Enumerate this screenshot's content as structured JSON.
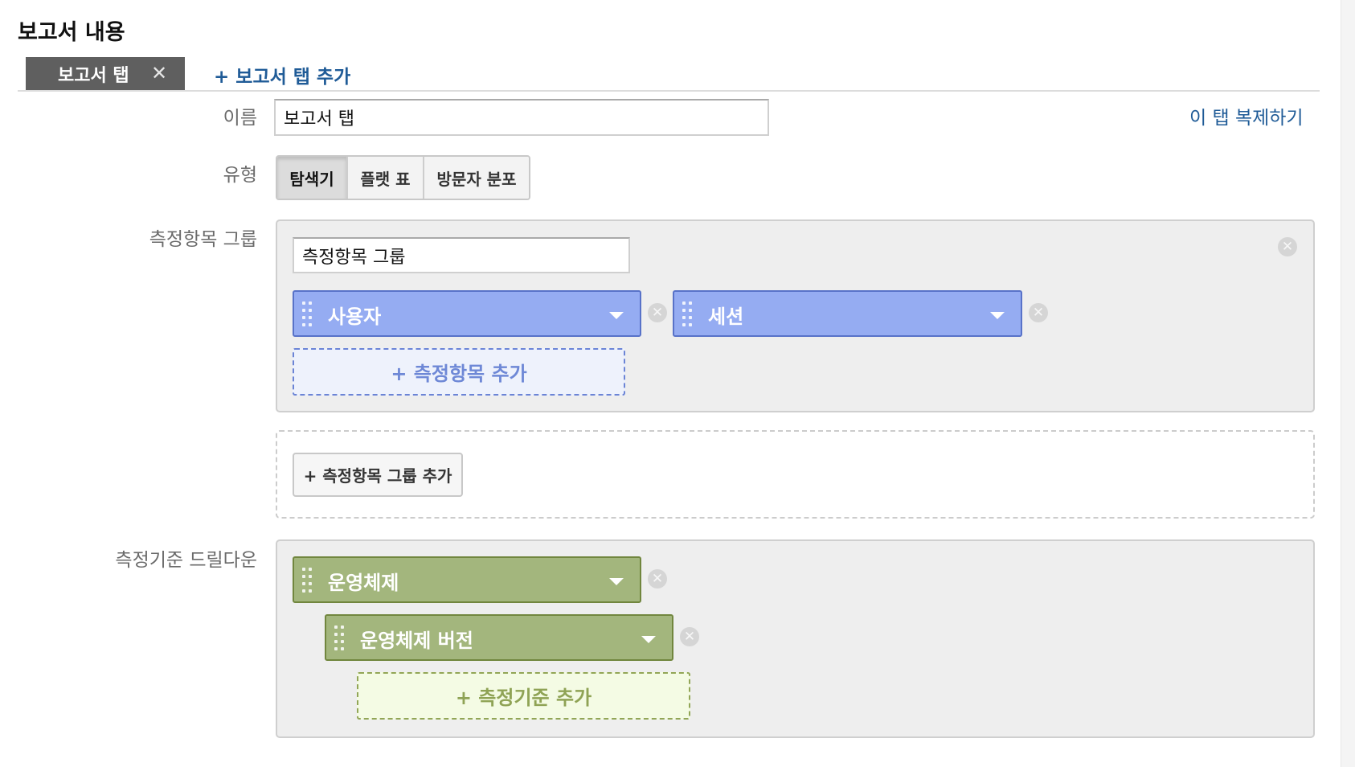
{
  "section_title": "보고서 내용",
  "tabs": {
    "active_label": "보고서 탭",
    "close_glyph": "✕",
    "add_label": "+ 보고서 탭 추가"
  },
  "name_field": {
    "label": "이름",
    "value": "보고서 탭"
  },
  "duplicate_link": "이 탭 복제하기",
  "type_field": {
    "label": "유형",
    "options": [
      "탐색기",
      "플랫 표",
      "방문자 분포"
    ],
    "selected": "탐색기"
  },
  "metric_group": {
    "label": "측정항목 그룹",
    "name_value": "측정항목 그룹",
    "metrics": [
      {
        "label": "사용자"
      },
      {
        "label": "세션"
      }
    ],
    "add_metric_label": "+ 측정항목 추가",
    "add_group_label": "+ 측정항목 그룹 추가"
  },
  "dimension_drilldown": {
    "label": "측정기준 드릴다운",
    "dimensions": [
      {
        "label": "운영체제"
      },
      {
        "label": "운영체제 버전"
      }
    ],
    "add_dimension_label": "+ 측정기준 추가"
  },
  "icons": {
    "remove": "remove-circle-icon",
    "dropdown": "chevron-down-icon",
    "drag": "drag-handle-icon",
    "close": "close-icon"
  },
  "colors": {
    "metric_chip": "#95acf2",
    "dimension_chip": "#a3b67d",
    "link": "#1f5b97",
    "active_tab": "#5f5f5f"
  }
}
